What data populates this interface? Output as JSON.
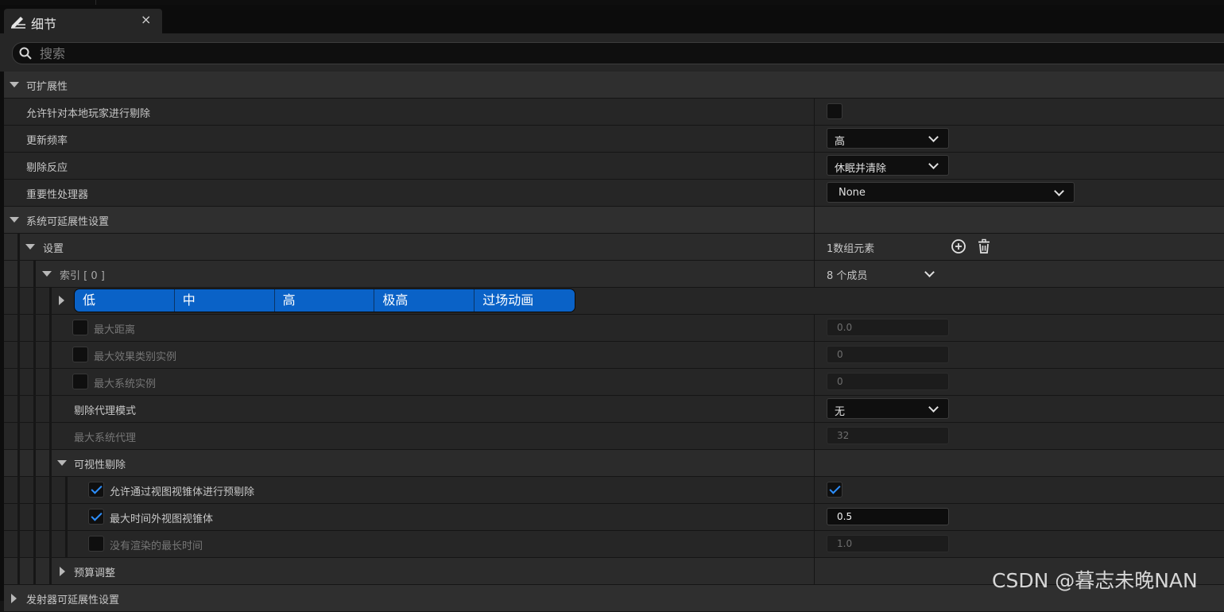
{
  "panel": {
    "tab_title": "细节",
    "close_label": "×"
  },
  "search": {
    "placeholder": "搜索"
  },
  "sections": {
    "scalability": {
      "label": "可扩展性"
    },
    "system_scalability": {
      "label": "系统可延展性设置"
    },
    "emitter_scalability": {
      "label": "发射器可延展性设置"
    }
  },
  "properties": {
    "allow_local_player_cull": {
      "label": "允许针对本地玩家进行剔除",
      "checked": false
    },
    "update_frequency": {
      "label": "更新频率",
      "value": "高"
    },
    "cull_reaction": {
      "label": "剔除反应",
      "value": "休眠并清除"
    },
    "significance_handler": {
      "label": "重要性处理器",
      "value": "None"
    },
    "settings": {
      "label": "设置",
      "count": "1数组元素"
    },
    "index0": {
      "label": "索引 [ 0 ]",
      "members": "8 个成员"
    },
    "quality_levels": [
      "低",
      "中",
      "高",
      "极高",
      "过场动画"
    ],
    "max_distance": {
      "label": "最大距离",
      "value": "0.0",
      "enabled": false
    },
    "max_instances": {
      "label": "最大效果类别实例",
      "value": "0",
      "enabled": false
    },
    "max_system_instances": {
      "label": "最大系统实例",
      "value": "0",
      "enabled": false
    },
    "cull_proxy_mode": {
      "label": "剔除代理模式",
      "value": "无"
    },
    "max_system_proxies": {
      "label": "最大系统代理",
      "value": "32"
    },
    "visibility_culling": {
      "label": "可视性剔除"
    },
    "allow_precull_frustum": {
      "label": "允许通过视图视锥体进行预剔除",
      "checked": true
    },
    "max_time_outside_frustum": {
      "label": "最大时间外视图视锥体",
      "checked": true,
      "value": "0.5"
    },
    "max_time_not_rendered": {
      "label": "没有渲染的最长时间",
      "checked": false,
      "value": "1.0"
    },
    "budget_scaling": {
      "label": "预算调整"
    }
  },
  "watermark": "CSDN @暮志未晚NAN",
  "colors": {
    "accent": "#0a62c7",
    "check": "#2d8fff",
    "panel_bg": "#262626",
    "category_bg": "#2f2f2f"
  }
}
